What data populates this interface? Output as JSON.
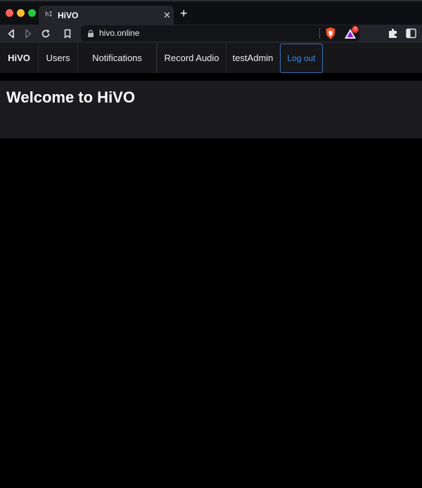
{
  "browser": {
    "tab": {
      "favicon_text": "hI",
      "title": "HiVO",
      "close_glyph": "✕"
    },
    "new_tab_glyph": "+",
    "address_bar": {
      "url": "hivo.online"
    },
    "rewards_badge_count": "3",
    "icons": [
      "back-icon",
      "forward-icon",
      "reload-icon",
      "bookmark-icon",
      "lock-icon",
      "brave-shield-icon",
      "brave-rewards-icon",
      "extensions-icon",
      "sidebar-icon"
    ],
    "colors": {
      "titlebar": "#0e0f13",
      "toolbar": "#24252b",
      "traffic_red": "#fe5f57",
      "traffic_yellow": "#febc2e",
      "traffic_green": "#28c840",
      "brave_orange": "#fb542b"
    }
  },
  "navbar": {
    "brand": "HiVO",
    "items": [
      {
        "label": "Users"
      },
      {
        "label": "Notifications"
      },
      {
        "label": "Record Audio"
      }
    ],
    "username": "testAdmin",
    "logout_label": "Log out",
    "colors": {
      "background": "#17171a",
      "logout_accent": "#3f8be3"
    }
  },
  "page": {
    "heading": "Welcome to HiVO",
    "colors": {
      "header_background": "#1c1c1e",
      "body_background": "#000000"
    }
  }
}
